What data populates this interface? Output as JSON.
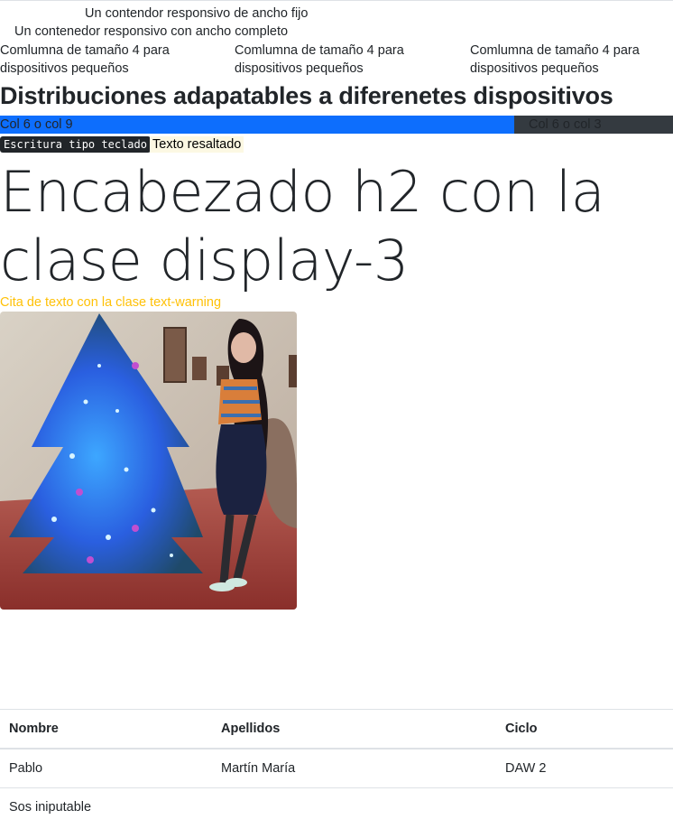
{
  "containers": {
    "fixed": "Un contendor responsivo de ancho fijo",
    "fluid": "Un contenedor responsivo con ancho completo"
  },
  "columns": [
    "Comlumna de tamaño 4 para dispositivos pequeños",
    "Comlumna de tamaño 4 para dispositivos pequeños",
    "Comlumna de tamaño 4 para dispositivos pequeños"
  ],
  "heading": "Distribuciones adapatables a diferenetes dispositivos",
  "bars": {
    "left": "Col 6 o col 9",
    "right": "Col 6 o col 3",
    "left_color": "#0d6efd",
    "right_color": "#343a40"
  },
  "kbd_text": "Escritura tipo teclado",
  "mark_text": "Texto resaltado",
  "display_heading": "Encabezado h2 con la clase display-3",
  "quote": "Cita de texto con la clase text-warning",
  "quote_color": "#ffc107",
  "image": {
    "icon": "photo-christmas-tree"
  },
  "table": {
    "headers": [
      "Nombre",
      "Apellidos",
      "Ciclo"
    ],
    "rows": [
      [
        "Pablo",
        "Martín María",
        "DAW 2"
      ],
      [
        "Sos iniputable",
        "",
        ""
      ]
    ]
  }
}
